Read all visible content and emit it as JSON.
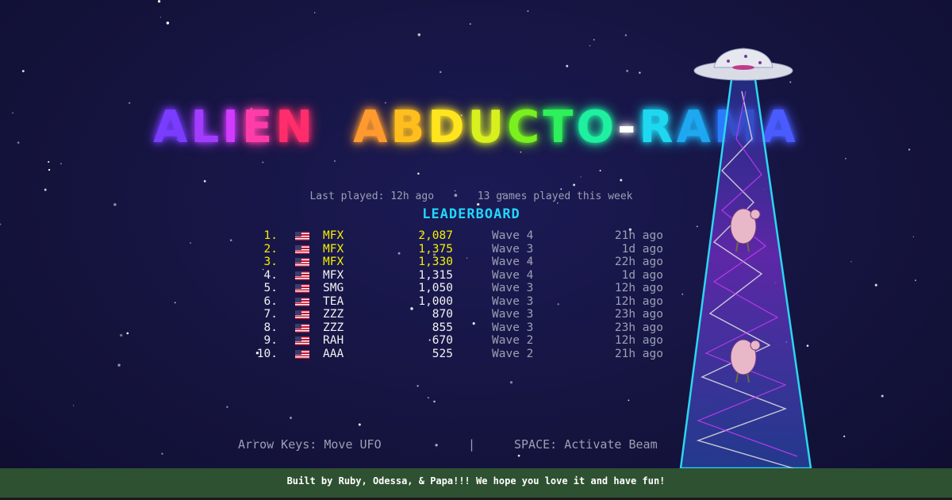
{
  "title": "ALIEN ABDUCTO-RAMA",
  "title_colors": [
    "#7a3cff",
    "#a23cff",
    "#d23cff",
    "#ff3ca8",
    "#ff2d6b",
    "#ffffff",
    "#ff9a2e",
    "#ffbe1e",
    "#ffe51e",
    "#d8f01e",
    "#7af01e",
    "#2ef05a",
    "#1ef0a0",
    "#ffffff",
    "#1ed8f0",
    "#1ea8f0",
    "#2a7cff",
    "#4a5cff"
  ],
  "status": {
    "last_played": "Last played: 12h ago",
    "separator": "•",
    "games_played": "13 games played this week"
  },
  "leaderboard": {
    "heading": "LEADERBOARD",
    "rows": [
      {
        "rank": "1.",
        "name": "MFX",
        "score": "2,087",
        "wave": "Wave 4",
        "time": "21h ago"
      },
      {
        "rank": "2.",
        "name": "MFX",
        "score": "1,375",
        "wave": "Wave 3",
        "time": "1d ago"
      },
      {
        "rank": "3.",
        "name": "MFX",
        "score": "1,330",
        "wave": "Wave 4",
        "time": "22h ago"
      },
      {
        "rank": "4.",
        "name": "MFX",
        "score": "1,315",
        "wave": "Wave 4",
        "time": "1d ago"
      },
      {
        "rank": "5.",
        "name": "SMG",
        "score": "1,050",
        "wave": "Wave 3",
        "time": "12h ago"
      },
      {
        "rank": "6.",
        "name": "TEA",
        "score": "1,000",
        "wave": "Wave 3",
        "time": "12h ago"
      },
      {
        "rank": "7.",
        "name": "ZZZ",
        "score": "870",
        "wave": "Wave 3",
        "time": "23h ago"
      },
      {
        "rank": "8.",
        "name": "ZZZ",
        "score": "855",
        "wave": "Wave 3",
        "time": "23h ago"
      },
      {
        "rank": "9.",
        "name": "RAH",
        "score": "670",
        "wave": "Wave 2",
        "time": "12h ago"
      },
      {
        "rank": "10.",
        "name": "AAA",
        "score": "525",
        "wave": "Wave 2",
        "time": "21h ago"
      }
    ],
    "flag_icon": "us-flag-icon",
    "highlight_color": "#f4f000"
  },
  "controls": {
    "move": "Arrow Keys: Move UFO",
    "divider": "|",
    "beam": "SPACE: Activate Beam"
  },
  "footer": {
    "text": "Built by Ruby, Odessa, & Papa!!! We hope you love it and have fun!"
  },
  "colors": {
    "background": "#15143f",
    "beam": "#2ad7f0",
    "footer": "#2e5131"
  }
}
